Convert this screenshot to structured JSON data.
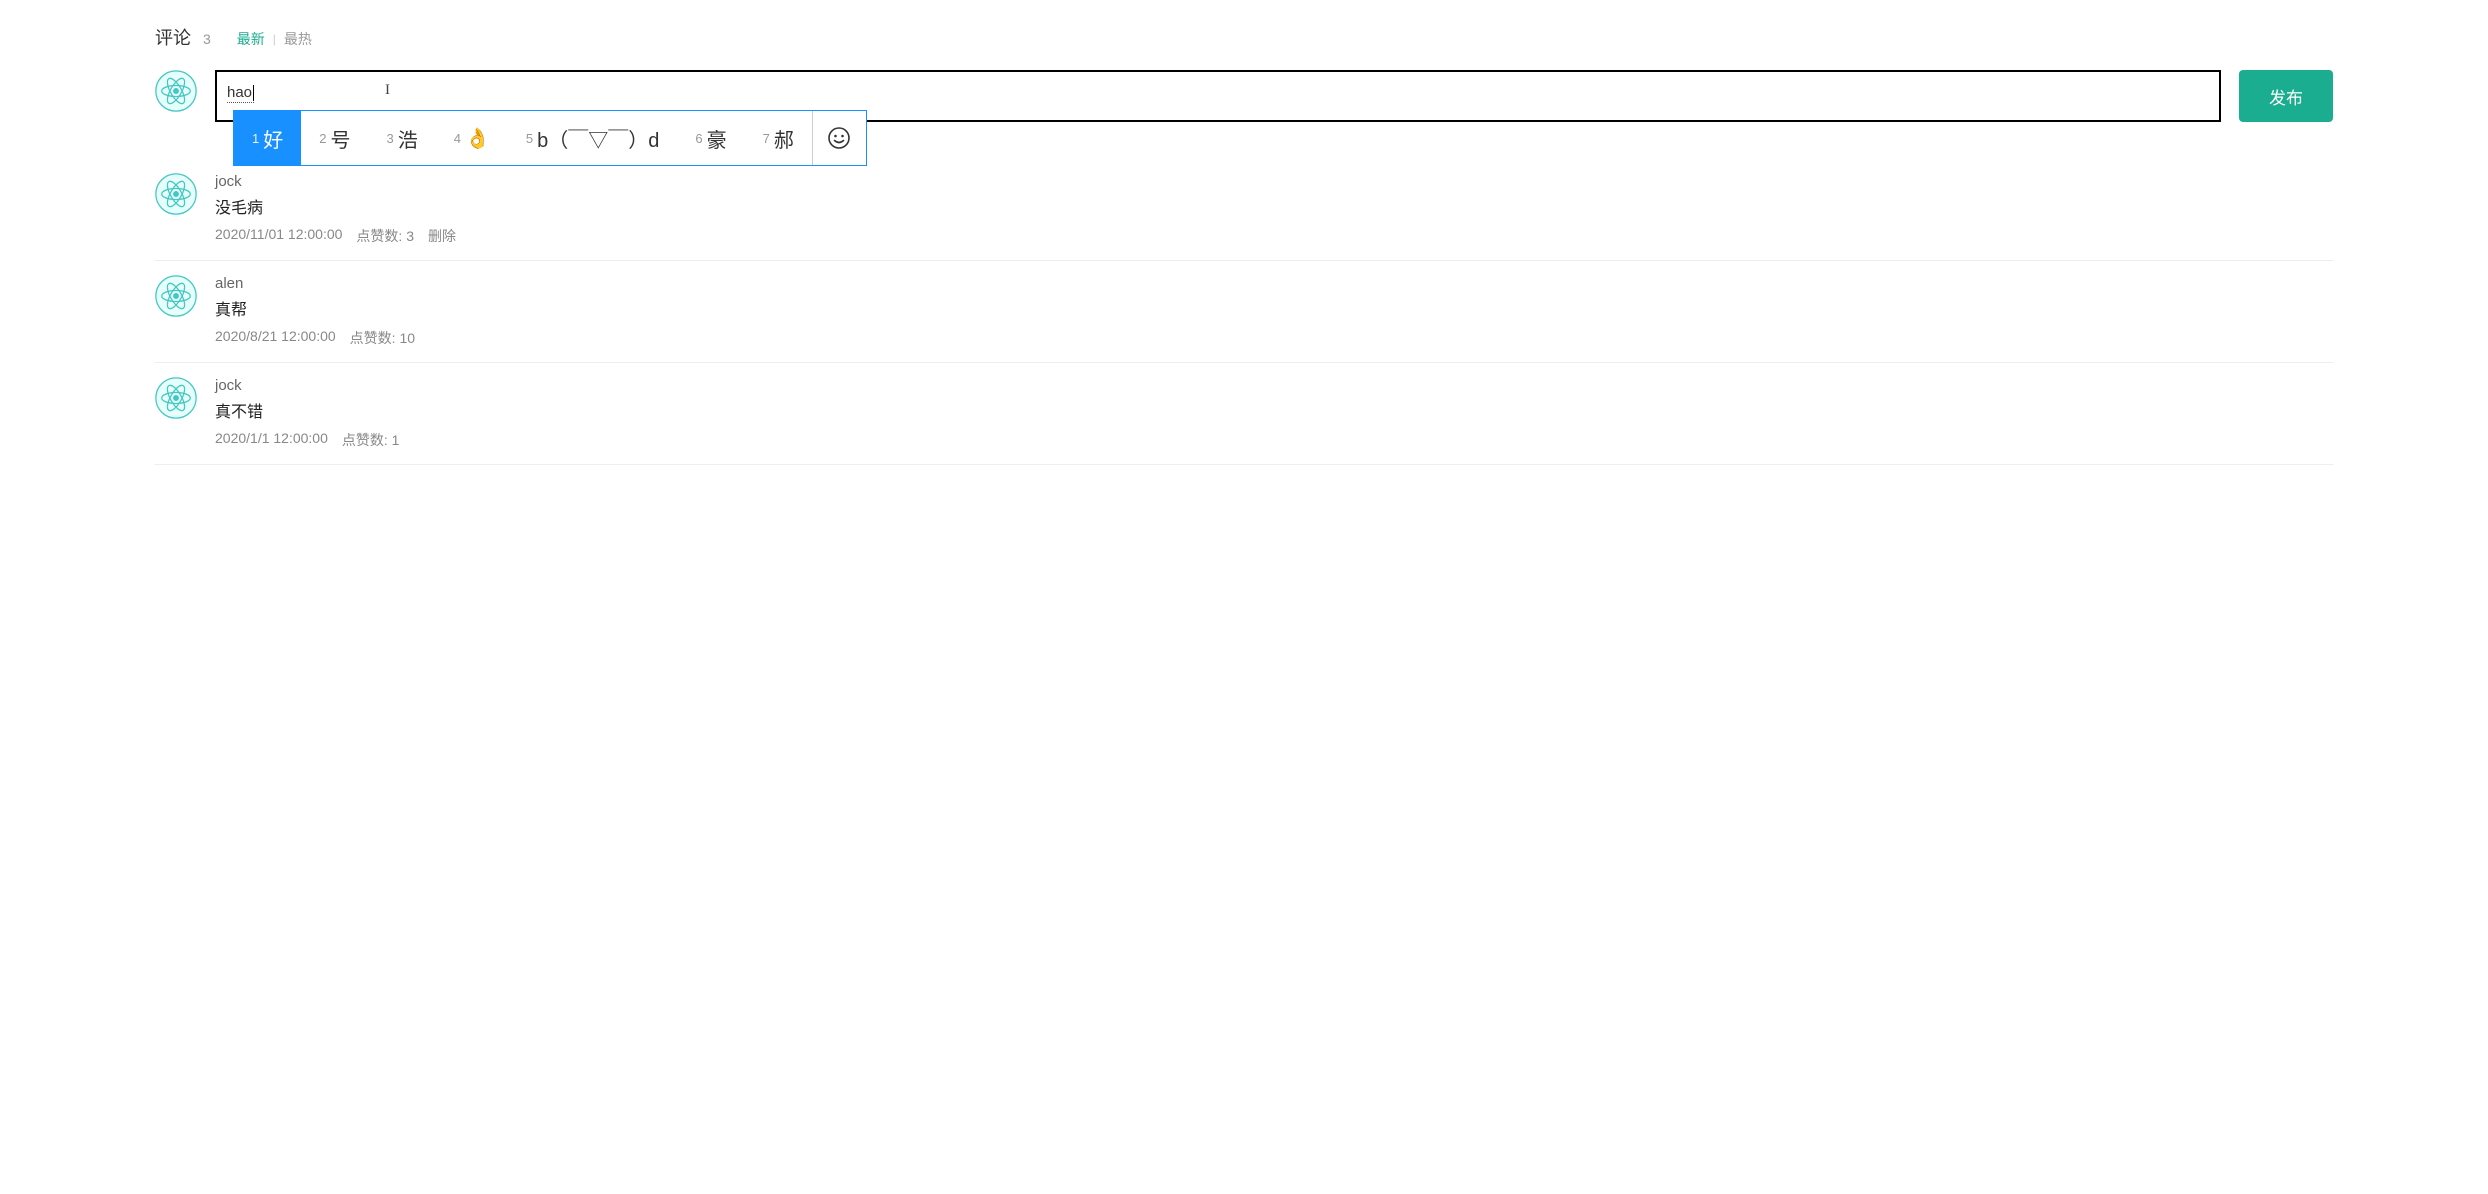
{
  "header": {
    "title": "评论",
    "count": "3",
    "tabs": {
      "latest": "最新",
      "hottest": "最热"
    }
  },
  "compose": {
    "ime_text": "hao",
    "publish_label": "发布",
    "candidates": [
      {
        "num": "1",
        "text": "好"
      },
      {
        "num": "2",
        "text": "号"
      },
      {
        "num": "3",
        "text": "浩"
      },
      {
        "num": "4",
        "text": "👌"
      },
      {
        "num": "5",
        "text": "b（￣▽￣）d"
      },
      {
        "num": "6",
        "text": "豪"
      },
      {
        "num": "7",
        "text": "郝"
      }
    ]
  },
  "like_label": "点赞数:",
  "delete_label": "删除",
  "comments": [
    {
      "user": "jock",
      "text": "没毛病",
      "time": "2020/11/01 12:00:00",
      "likes": "3",
      "can_delete": true
    },
    {
      "user": "alen",
      "text": "真帮",
      "time": "2020/8/21 12:00:00",
      "likes": "10",
      "can_delete": false
    },
    {
      "user": "jock",
      "text": "真不错",
      "time": "2020/1/1 12:00:00",
      "likes": "1",
      "can_delete": false
    }
  ]
}
